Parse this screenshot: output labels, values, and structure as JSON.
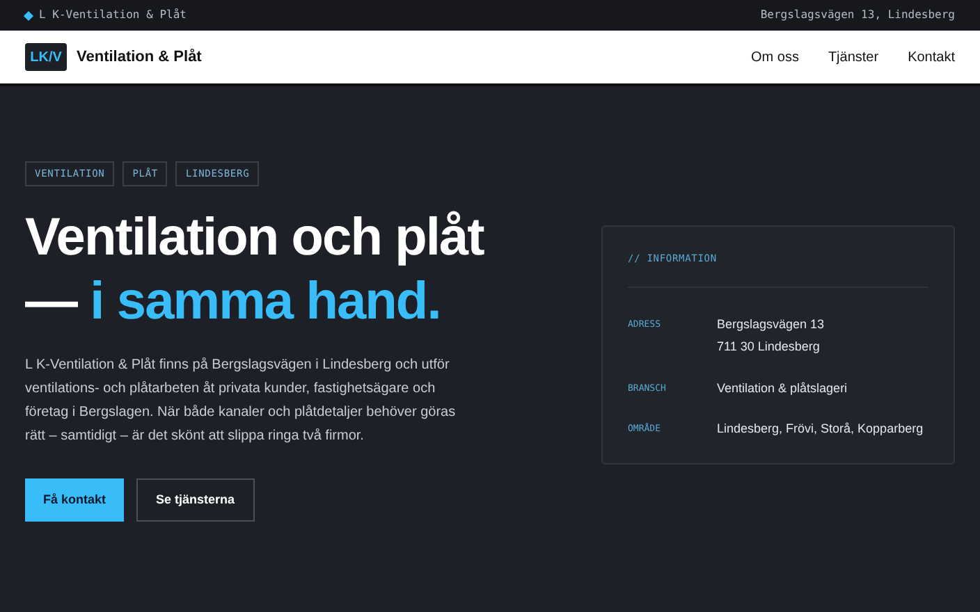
{
  "topbar": {
    "brand": "L K-Ventilation & Plåt",
    "address": "Bergslagsvägen 13, Lindesberg"
  },
  "header": {
    "logo": "LK/V",
    "title": "Ventilation & Plåt",
    "nav": [
      "Om oss",
      "Tjänster",
      "Kontakt"
    ]
  },
  "tags": [
    "VENTILATION",
    "PLÅT",
    "LINDESBERG"
  ],
  "hero": {
    "title_line1": "Ventilation och plåt",
    "title_dash": "—",
    "title_accent": "i samma hand.",
    "body": "L K-Ventilation & Plåt finns på Bergslagsvägen i Lindesberg och utför ventilations- och plåtarbeten åt privata kunder, fastighetsägare och företag i Bergslagen. När både kanaler och plåtdetaljer behöver göras rätt – samtidigt – är det skönt att slippa ringa två firmor.",
    "buttons": [
      {
        "label": "Få kontakt",
        "kind": "primary"
      },
      {
        "label": "Se tjänsterna",
        "kind": "secondary"
      }
    ]
  },
  "info": {
    "heading": "// INFORMATION",
    "rows": [
      {
        "label": "ADRESS",
        "lines": [
          "Bergslagsvägen 13",
          "711 30 Lindesberg"
        ]
      },
      {
        "label": "BRANSCH",
        "lines": [
          "Ventilation & plåtslageri"
        ]
      },
      {
        "label": "OMRÅDE",
        "lines": [
          "Lindesberg, Frövi, Storå, Kopparberg"
        ]
      }
    ]
  }
}
